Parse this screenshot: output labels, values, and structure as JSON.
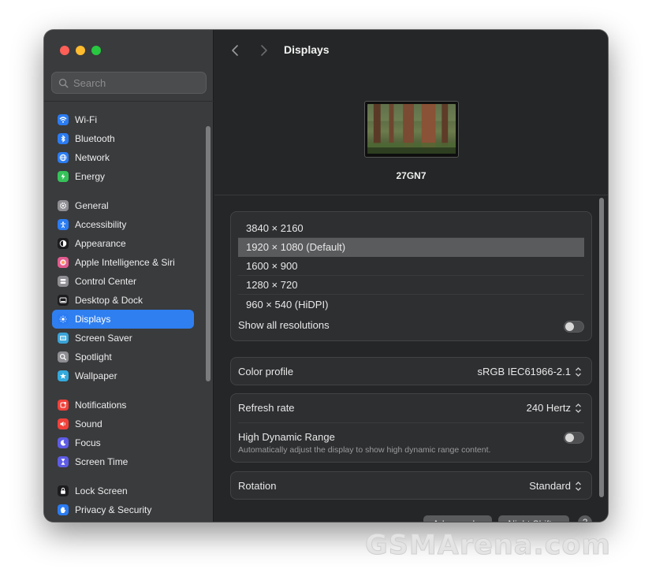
{
  "window": {
    "title": "Displays"
  },
  "search": {
    "placeholder": "Search"
  },
  "sidebar": {
    "groups": [
      [
        {
          "label": "Wi-Fi",
          "icon": "wifi-icon",
          "color": "#2b7cf3"
        },
        {
          "label": "Bluetooth",
          "icon": "bluetooth-icon",
          "color": "#2b7cf3"
        },
        {
          "label": "Network",
          "icon": "globe-icon",
          "color": "#2b7cf3"
        },
        {
          "label": "Energy",
          "icon": "battery-icon",
          "color": "#35c25a"
        }
      ],
      [
        {
          "label": "General",
          "icon": "gear-icon",
          "color": "#8e8e93"
        },
        {
          "label": "Accessibility",
          "icon": "accessibility-icon",
          "color": "#2b7cf3"
        },
        {
          "label": "Appearance",
          "icon": "appearance-icon",
          "color": "#1c1c1e"
        },
        {
          "label": "Apple Intelligence & Siri",
          "icon": "siri-icon",
          "color": "#e25b8f"
        },
        {
          "label": "Control Center",
          "icon": "control-center-icon",
          "color": "#8e8e93"
        },
        {
          "label": "Desktop & Dock",
          "icon": "dock-icon",
          "color": "#1c1c1e"
        },
        {
          "label": "Displays",
          "icon": "sun-icon",
          "color": "#2b7cf3",
          "active": true
        },
        {
          "label": "Screen Saver",
          "icon": "screen-saver-icon",
          "color": "#3aa4d8"
        },
        {
          "label": "Spotlight",
          "icon": "magnifier-icon",
          "color": "#8e8e93"
        },
        {
          "label": "Wallpaper",
          "icon": "wallpaper-icon",
          "color": "#34aadc"
        }
      ],
      [
        {
          "label": "Notifications",
          "icon": "bell-icon",
          "color": "#f0413a"
        },
        {
          "label": "Sound",
          "icon": "speaker-icon",
          "color": "#f0413a"
        },
        {
          "label": "Focus",
          "icon": "moon-icon",
          "color": "#5e5ce6"
        },
        {
          "label": "Screen Time",
          "icon": "hourglass-icon",
          "color": "#5e5ce6"
        }
      ],
      [
        {
          "label": "Lock Screen",
          "icon": "lock-icon",
          "color": "#1c1c1e"
        },
        {
          "label": "Privacy & Security",
          "icon": "hand-icon",
          "color": "#2b7cf3"
        }
      ]
    ]
  },
  "display": {
    "name": "27GN7"
  },
  "resolutions": {
    "items": [
      {
        "label": "3840 × 2160"
      },
      {
        "label": "1920 × 1080 (Default)",
        "selected": true
      },
      {
        "label": "1600 × 900"
      },
      {
        "label": "1280 × 720"
      },
      {
        "label": "960 × 540 (HiDPI)"
      }
    ],
    "show_all_label": "Show all resolutions",
    "show_all_enabled": false
  },
  "color_profile": {
    "label": "Color profile",
    "value": "sRGB IEC61966-2.1"
  },
  "refresh_rate": {
    "label": "Refresh rate",
    "value": "240 Hertz"
  },
  "hdr": {
    "label": "High Dynamic Range",
    "description": "Automatically adjust the display to show high dynamic range content.",
    "enabled": false
  },
  "rotation": {
    "label": "Rotation",
    "value": "Standard"
  },
  "bottom_buttons": {
    "advanced": "Advanced...",
    "night_shift": "Night Shift...",
    "help": "?"
  },
  "watermark": "GSMArena.com",
  "colors": {
    "accent": "#2f7ff0",
    "sidebar_bg": "#3a3b3d",
    "main_bg": "#252627"
  }
}
